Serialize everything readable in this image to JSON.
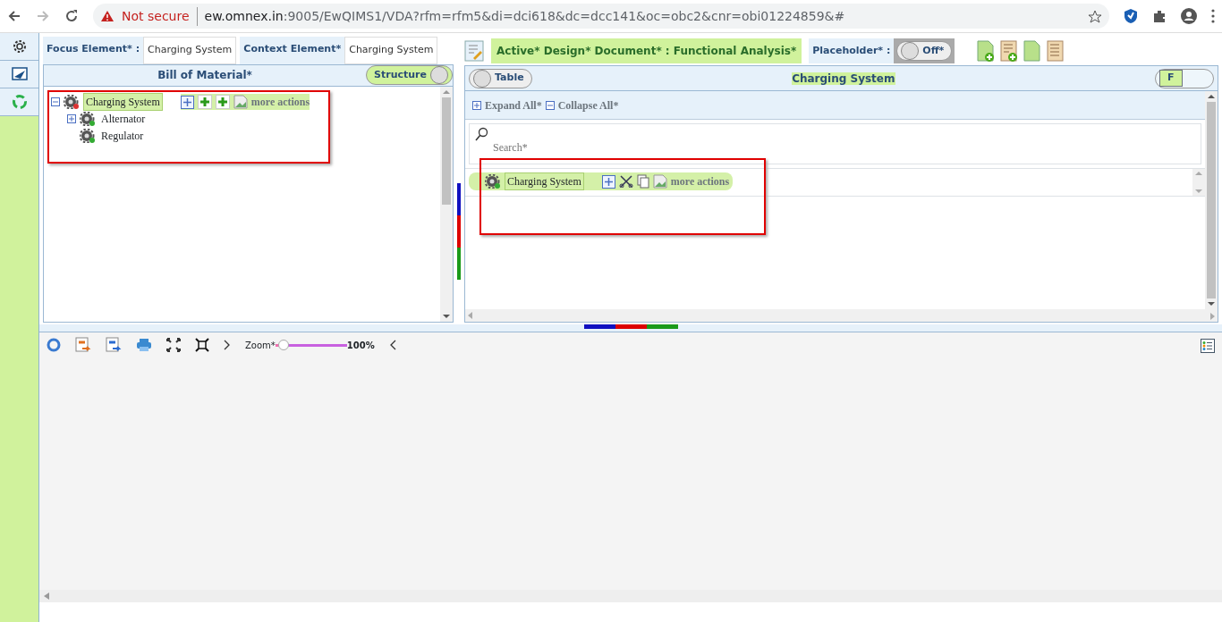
{
  "browser": {
    "security": "Not secure",
    "url_host": "ew.omnex.in",
    "url_path": ":9005/EwQIMS1/VDA?rfm=rfm5&di=dci618&dc=dcc141&oc=obc2&cnr=obi01224859&#"
  },
  "focus_element": {
    "label": "Focus Element* :",
    "value": "Charging System"
  },
  "context_element": {
    "label": "Context Element*",
    "value": "Charging System"
  },
  "bom_panel": {
    "title": "Bill of Material*",
    "structure_toggle": {
      "label": "Structure",
      "on": true
    },
    "tree": [
      {
        "label": "Charging System",
        "expanded": true,
        "selected": true,
        "actions_alt": "more actions",
        "children": [
          {
            "label": "Alternator",
            "expanded": false,
            "selected": false
          },
          {
            "label": "Regulator",
            "selected": false
          }
        ]
      }
    ]
  },
  "document_badge": "Active* Design* Document* : Functional Analysis*",
  "placeholder": {
    "label": "Placeholder* :",
    "toggle_label": "Off*",
    "on": false
  },
  "analysis_panel": {
    "table_toggle": {
      "label": "Table",
      "on": false
    },
    "title": "Charging System",
    "f_toggle": {
      "label": "F",
      "on": true
    },
    "expand_all": "Expand All*",
    "collapse_all": "Collapse All*",
    "search": {
      "placeholder": "Search*"
    },
    "rows": [
      {
        "label": "Charging System",
        "actions_alt": "more actions"
      }
    ]
  },
  "zoom": {
    "label": "Zoom*",
    "level": 0.12,
    "reading": "100%"
  }
}
